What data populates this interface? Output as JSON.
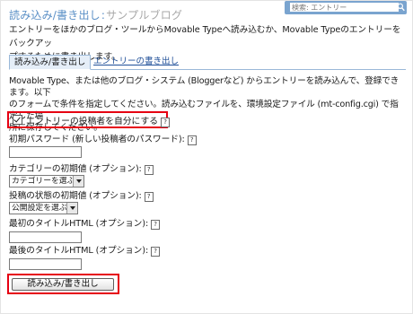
{
  "header": {
    "section_title": "読み込み/書き出し",
    "separator": ":",
    "blog_name": "サンプルブログ"
  },
  "search": {
    "placeholder": "検索: エントリー",
    "icon": "search-icon"
  },
  "intro": {
    "line1": "エントリーをほかのブログ・ツールからMovable Typeへ読み込むか、Movable Typeのエントリーをバックアッ",
    "line2": "プするために書き出します。"
  },
  "tabs": [
    {
      "label": "読み込み/書き出し",
      "active": true
    },
    {
      "label": "エントリーの書き出し",
      "active": false
    }
  ],
  "description": {
    "line1": "Movable Type、または他のブログ・システム (Bloggerなど) からエントリーを読み込んで、登録できます。以下",
    "line2": "のフォームで条件を指定してください。読み込むファイルを、環境設定ファイル (mt-config.cgi) で指定した場",
    "line3": "所に保存してください。"
  },
  "form": {
    "author_checkbox_label": "エントリーの投稿者を自分にする",
    "author_checkbox_checked": true,
    "default_password_label": "初期パスワード (新しい投稿者のパスワード):",
    "default_password_value": "",
    "default_category_label": "カテゴリーの初期値 (オプション):",
    "default_category_selected": "カテゴリーを選ぶ",
    "default_status_label": "投稿の状態の初期値 (オプション):",
    "default_status_selected": "公開設定を選ぶ",
    "title_start_label": "最初のタイトルHTML (オプション):",
    "title_start_value": "",
    "title_end_label": "最後のタイトルHTML (オプション):",
    "title_end_value": "",
    "help_glyph": "?",
    "submit_label": "読み込み/書き出し"
  },
  "colors": {
    "accent": "#5a8fc6",
    "highlight": "#e60012",
    "link": "#1f4f98",
    "tab_active_bg": "#e5eef8"
  }
}
